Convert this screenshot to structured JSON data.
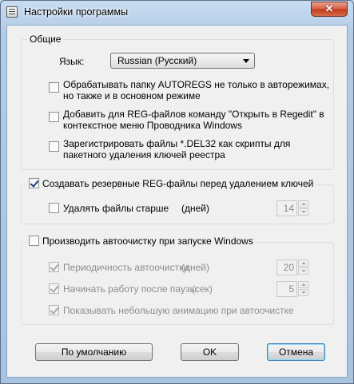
{
  "window": {
    "title": "Настройки программы",
    "close_label": "✕"
  },
  "general": {
    "title": "Общие",
    "language_label": "Язык:",
    "language_value": "Russian  (Русский)",
    "options": [
      {
        "line1": "Обрабатывать папку AUTOREGS не только в авторежимах,",
        "line2": "но также и в основном режиме",
        "checked": false
      },
      {
        "line1": "Добавить для REG-файлов команду \"Открыть в Regedit\" в",
        "line2": "контекстное меню Проводника Windows",
        "checked": false
      },
      {
        "line1": "Зарегистрировать файлы *.DEL32 как скрипты для",
        "line2": "пакетного удаления ключей реестра",
        "checked": false
      }
    ]
  },
  "backup": {
    "label": "Создавать резервные REG-файлы перед удалением ключей",
    "checked": true,
    "delete_old_label": "Удалять файлы старше",
    "delete_old_checked": false,
    "unit": "(дней)",
    "days_value": "14"
  },
  "autoclean": {
    "label": "Производить автоочистку при запуске Windows",
    "checked": false,
    "period_label": "Периодичность автоочистки",
    "period_unit": "(дней)",
    "period_value": "20",
    "period_checked": true,
    "pause_label": "Начинать работу после паузы",
    "pause_unit": "(сек)",
    "pause_value": "5",
    "pause_checked": true,
    "animation_label": "Показывать небольшую анимацию при автоочистке",
    "animation_checked": true
  },
  "buttons": {
    "default": "По умолчанию",
    "ok": "OK",
    "cancel": "Отмена"
  }
}
